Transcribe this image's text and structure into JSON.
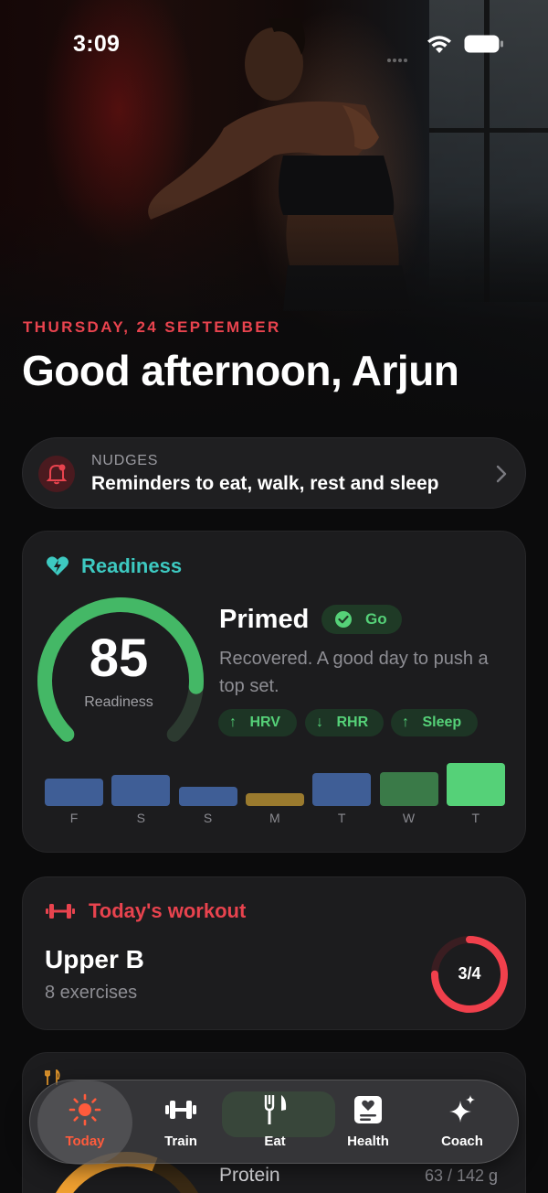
{
  "status_bar": {
    "time": "3:09"
  },
  "header": {
    "date": "THURSDAY, 24 SEPTEMBER",
    "greeting": "Good afternoon, Arjun"
  },
  "nudges": {
    "eyebrow": "NUDGES",
    "text": "Reminders to eat, walk, rest and sleep"
  },
  "readiness": {
    "title": "Readiness",
    "score": "85",
    "score_fraction": 0.85,
    "score_label": "Readiness",
    "status": "Primed",
    "badge": "Go",
    "description": "Recovered. A good day to push a top set.",
    "metrics": [
      {
        "direction": "up",
        "arrow": "↑",
        "label": "HRV"
      },
      {
        "direction": "down",
        "arrow": "↓",
        "label": "RHR"
      },
      {
        "direction": "up",
        "arrow": "↑",
        "label": "Sleep"
      }
    ],
    "week": {
      "days": [
        "F",
        "S",
        "S",
        "M",
        "T",
        "W",
        "T"
      ],
      "levels": [
        0.55,
        0.62,
        0.38,
        0.25,
        0.65,
        0.68,
        0.85
      ],
      "colors": [
        "#3f5e96",
        "#3f5e96",
        "#3f5e96",
        "#9a7a2e",
        "#3f5e96",
        "#3a7a48",
        "#55d178"
      ]
    }
  },
  "workout": {
    "title": "Today's workout",
    "name": "Upper B",
    "subtitle": "8 exercises",
    "progress_label": "3/4",
    "progress_fraction": 0.75
  },
  "nutrition": {
    "protein_label": "Protein",
    "protein_value": "63 / 142 g"
  },
  "tabbar": {
    "tabs": [
      {
        "label": "Today",
        "icon": "sun-icon",
        "active": true
      },
      {
        "label": "Train",
        "icon": "dumbbell-icon",
        "active": false
      },
      {
        "label": "Eat",
        "icon": "fork-knife-icon",
        "active": false
      },
      {
        "label": "Health",
        "icon": "health-card-icon",
        "active": false
      },
      {
        "label": "Coach",
        "icon": "sparkles-icon",
        "active": false
      }
    ]
  },
  "colors": {
    "accent_red": "#e8434e",
    "accent_teal": "#3dc9c1",
    "accent_green": "#55d178",
    "tab_active": "#ff5b3c"
  }
}
